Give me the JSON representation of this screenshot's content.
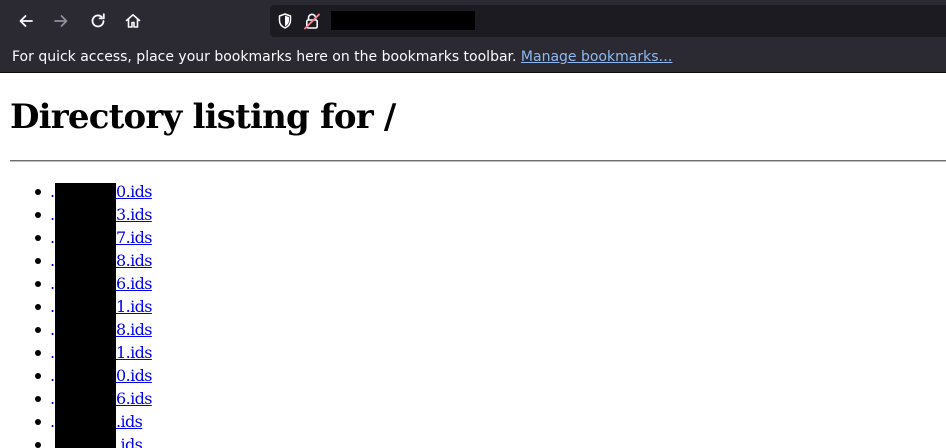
{
  "browser": {
    "url_redacted": "",
    "icons": [
      "back-arrow-icon",
      "forward-arrow-icon",
      "reload-icon",
      "home-icon",
      "tracking-shield-icon",
      "insecure-lock-icon"
    ]
  },
  "bookmarks_bar": {
    "message": "For quick access, place your bookmarks here on the bookmarks toolbar. ",
    "manage_link": "Manage bookmarks…"
  },
  "page": {
    "title": "Directory listing for /",
    "files": [
      {
        "label": "0.ids"
      },
      {
        "label": "3.ids"
      },
      {
        "label": "7.ids"
      },
      {
        "label": "8.ids"
      },
      {
        "label": "6.ids"
      },
      {
        "label": "1.ids"
      },
      {
        "label": "8.ids"
      },
      {
        "label": "1.ids"
      },
      {
        "label": "0.ids"
      },
      {
        "label": "6.ids"
      },
      {
        "label": ".ids"
      },
      {
        "label": ".ids"
      }
    ]
  },
  "colors": {
    "toolbar_bg": "#2b2a33",
    "urlbar_bg": "#1c1b22",
    "link": "#0000ee",
    "bookmark_link": "#8fb8f0",
    "lock_alert": "#ff848b"
  }
}
